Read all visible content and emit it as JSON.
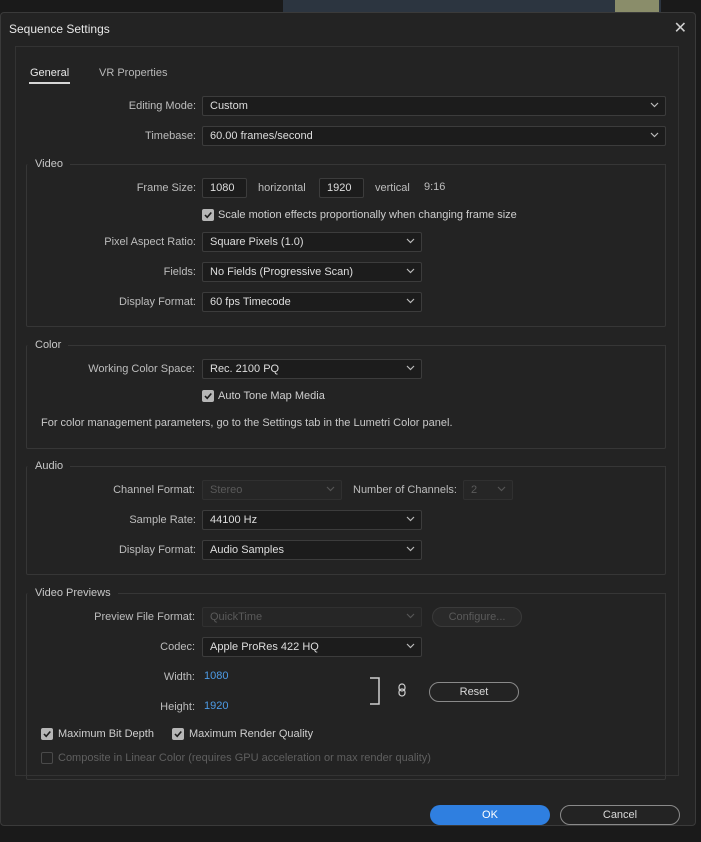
{
  "dialog": {
    "title": "Sequence Settings"
  },
  "tabs": {
    "general": "General",
    "vr": "VR Properties"
  },
  "editing_mode": {
    "label": "Editing Mode:",
    "value": "Custom"
  },
  "timebase": {
    "label": "Timebase:",
    "value": "60.00  frames/second"
  },
  "video": {
    "title": "Video",
    "frame_size_label": "Frame Size:",
    "width": "1080",
    "horizontal_label": "horizontal",
    "height": "1920",
    "vertical_label": "vertical",
    "ratio": "9:16",
    "scale_motion_label": "Scale motion effects proportionally when changing frame size",
    "pixel_aspect_label": "Pixel Aspect Ratio:",
    "pixel_aspect_value": "Square Pixels (1.0)",
    "fields_label": "Fields:",
    "fields_value": "No Fields (Progressive Scan)",
    "display_format_label": "Display Format:",
    "display_format_value": "60 fps Timecode"
  },
  "color": {
    "title": "Color",
    "working_space_label": "Working Color Space:",
    "working_space_value": "Rec. 2100 PQ",
    "auto_tone_label": "Auto Tone Map Media",
    "info_text": "For color management parameters, go to the Settings tab in the Lumetri Color panel."
  },
  "audio": {
    "title": "Audio",
    "channel_format_label": "Channel Format:",
    "channel_format_value": "Stereo",
    "num_channels_label": "Number of Channels:",
    "num_channels_value": "2",
    "sample_rate_label": "Sample Rate:",
    "sample_rate_value": "44100 Hz",
    "display_format_label": "Display Format:",
    "display_format_value": "Audio Samples"
  },
  "previews": {
    "title": "Video Previews",
    "file_format_label": "Preview File Format:",
    "file_format_value": "QuickTime",
    "configure_label": "Configure...",
    "codec_label": "Codec:",
    "codec_value": "Apple ProRes 422 HQ",
    "width_label": "Width:",
    "width_value": "1080",
    "height_label": "Height:",
    "height_value": "1920",
    "reset_label": "Reset",
    "max_bit_depth_label": "Maximum Bit Depth",
    "max_render_quality_label": "Maximum Render Quality",
    "linear_color_label": "Composite in Linear Color (requires GPU acceleration or max render quality)"
  },
  "buttons": {
    "ok": "OK",
    "cancel": "Cancel"
  }
}
